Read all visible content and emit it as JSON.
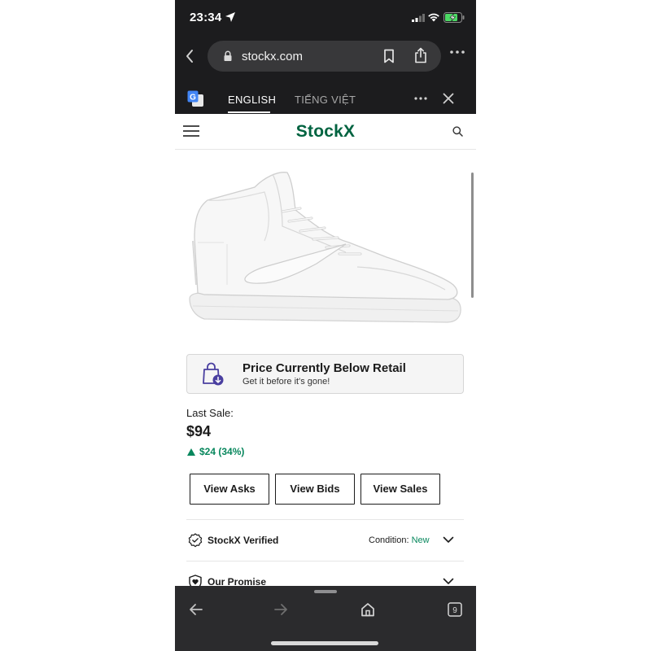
{
  "status_bar": {
    "time": "23:34"
  },
  "browser": {
    "url": "stockx.com"
  },
  "translate_bar": {
    "tab_active": "ENGLISH",
    "tab_other": "TIẾNG VIỆT"
  },
  "site": {
    "logo_text": "StockX"
  },
  "notice": {
    "title": "Price Currently Below Retail",
    "subtitle": "Get it before it's gone!"
  },
  "last_sale": {
    "label": "Last Sale:",
    "price": "$94",
    "change": "$24 (34%)"
  },
  "buttons": {
    "asks": "View Asks",
    "bids": "View Bids",
    "sales": "View Sales"
  },
  "accordion": {
    "verified_title": "StockX Verified",
    "condition_label": "Condition:",
    "condition_value": "New",
    "promise_title": "Our Promise"
  },
  "colors": {
    "brand_green": "#006340",
    "positive_green": "#08875d",
    "chrome_dark": "#1c1c1e"
  },
  "tab_count": "9"
}
